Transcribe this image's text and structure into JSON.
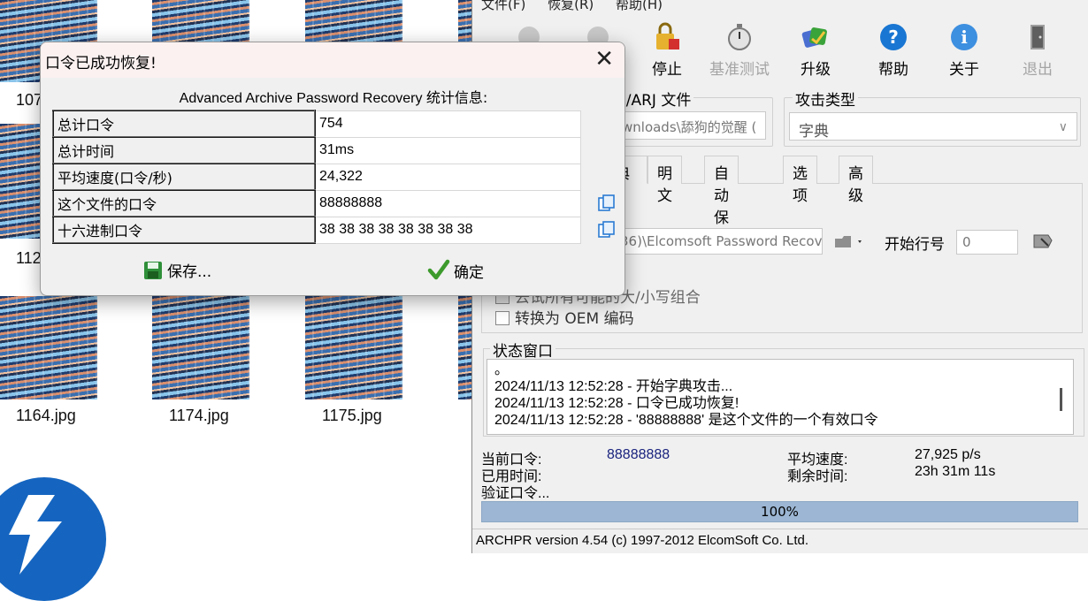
{
  "desktop": {
    "files": [
      "107",
      "112",
      "1164.jpg",
      "1174.jpg",
      "1175.jpg"
    ]
  },
  "app": {
    "menu": [
      "文件(F)",
      "恢复(R)",
      "帮助(H)"
    ],
    "toolbar": {
      "stop": "停止",
      "benchmark": "基准测试",
      "upgrade": "升级",
      "help": "帮助",
      "about": "关于",
      "exit": "退出"
    },
    "encrypted_file_label": "E/ARJ 文件",
    "file_path": "wnloads\\舔狗的觉醒 (",
    "attack_type_label": "攻击类型",
    "attack_type_value": "字典",
    "tabs": [
      "典",
      "明文",
      "自动保存",
      "选项",
      "高级"
    ],
    "dict_path": "36)\\Elcomsoft Password Recove",
    "start_line_label": "开始行号",
    "start_line_value": "0",
    "check_all_case": "去试所有可能的大/小写组合",
    "check_oem": "转换为 OEM 编码",
    "status_window_label": "状态窗口",
    "log": [
      "。",
      "2024/11/13 12:52:28 - 开始字典攻击...",
      "2024/11/13 12:52:28 - 口令已成功恢复!",
      "2024/11/13 12:52:28 - '88888888' 是这个文件的一个有效口令"
    ],
    "current_password_label": "当前口令:",
    "current_password_value": "88888888",
    "elapsed_label": "已用时间:",
    "verify_label": "验证口令...",
    "avg_speed_label": "平均速度:",
    "avg_speed_value": "27,925 p/s",
    "remaining_label": "剩余时间:",
    "remaining_value": "23h 31m 11s",
    "progress_percent": 100,
    "progress_text": "100%",
    "statusbar": "ARCHPR version 4.54 (c) 1997-2012 ElcomSoft Co. Ltd."
  },
  "dialog": {
    "title": "口令已成功恢复!",
    "heading_en": "Advanced Archive Password Recovery",
    "heading_cn": "统计信息:",
    "rows": [
      {
        "key": "总计口令",
        "value": "754"
      },
      {
        "key": "总计时间",
        "value": "31ms"
      },
      {
        "key": "平均速度(口令/秒)",
        "value": "24,322"
      },
      {
        "key": "这个文件的口令",
        "value": "88888888"
      },
      {
        "key": "十六进制口令",
        "value": "38 38 38 38 38 38 38 38"
      }
    ],
    "save_label": "保存...",
    "ok_label": "确定"
  },
  "colors": {
    "progress": "#9cb6d3",
    "password_value": "#1a237e",
    "ok_check": "#3c9a2c"
  }
}
